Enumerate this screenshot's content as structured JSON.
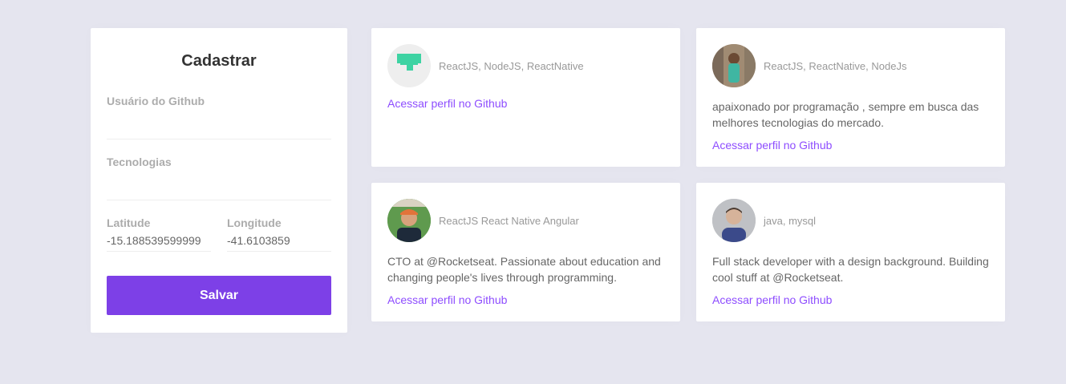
{
  "form": {
    "title": "Cadastrar",
    "github_username_label": "Usuário do Github",
    "github_username_value": "",
    "techs_label": "Tecnologias",
    "techs_value": "",
    "latitude_label": "Latitude",
    "latitude_value": "-15.188539599999",
    "longitude_label": "Longitude",
    "longitude_value": "-41.6103859",
    "save_label": "Salvar"
  },
  "devs": [
    {
      "techs": "ReactJS, NodeJS, ReactNative",
      "bio": "",
      "link": "Acessar perfil no Github",
      "avatar_icon": "logo-avatar-icon"
    },
    {
      "techs": "ReactJS, ReactNative, NodeJs",
      "bio": "apaixonado por programação , sempre em busca das melhores tecnologias do mercado.",
      "link": "Acessar perfil no Github",
      "avatar_icon": "person-avatar-icon"
    },
    {
      "techs": "ReactJS React Native Angular",
      "bio": "CTO at @Rocketseat. Passionate about education and changing people's lives through programming.",
      "link": "Acessar perfil no Github",
      "avatar_icon": "person-avatar-icon"
    },
    {
      "techs": "java, mysql",
      "bio": "Full stack developer with a design background. Building cool stuff at @Rocketseat.",
      "link": "Acessar perfil no Github",
      "avatar_icon": "person-avatar-icon"
    }
  ],
  "colors": {
    "background": "#e5e5ef",
    "primary": "#7d40e7",
    "link": "#8e4dff"
  }
}
